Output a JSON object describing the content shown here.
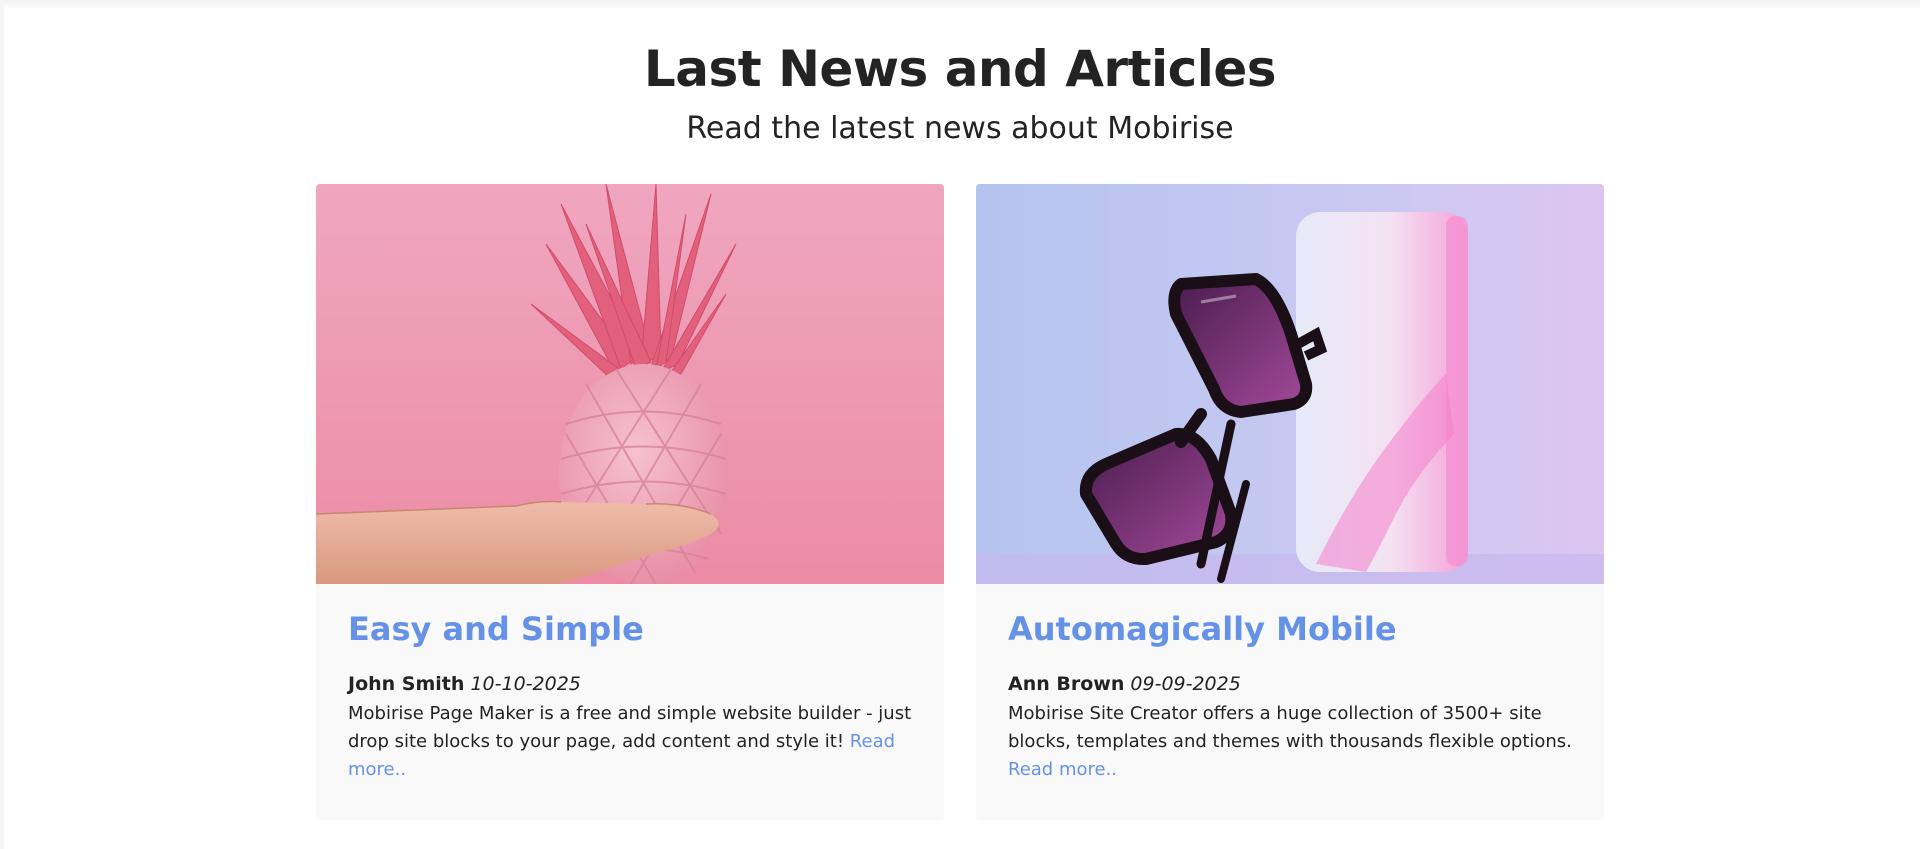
{
  "section": {
    "title": "Last News and Articles",
    "subtitle": "Read the latest news about Mobirise"
  },
  "colors": {
    "accent": "#6592e6",
    "text": "#232323",
    "card_background": "#f9f9f9"
  },
  "cards": [
    {
      "image": "pink-pineapple-photo",
      "title": "Easy and Simple",
      "author": "John Smith",
      "date": "10-10-2025",
      "text": "Mobirise Page Maker is a free and simple website builder - just drop site blocks to your page, add content and style it!",
      "read_more": "Read more.."
    },
    {
      "image": "sunglasses-photo",
      "title": "Automagically Mobile",
      "author": "Ann Brown",
      "date": "09-09-2025",
      "text": "Mobirise Site Creator offers a huge collection of 3500+ site blocks, templates and themes with thousands flexible options.",
      "read_more": "Read more.."
    }
  ]
}
